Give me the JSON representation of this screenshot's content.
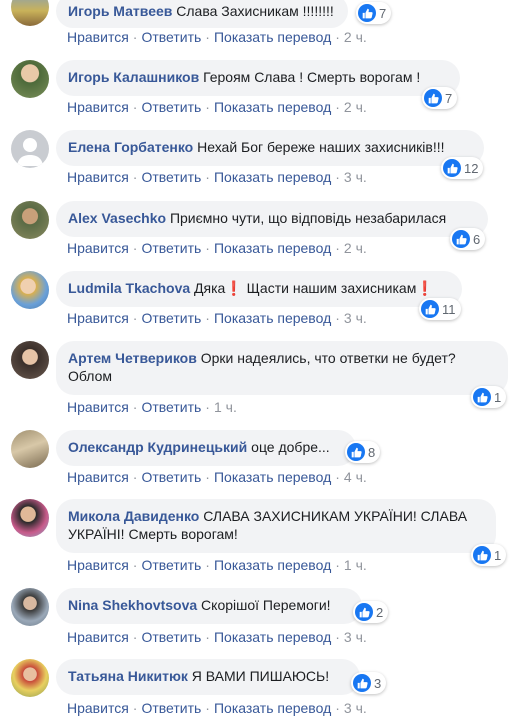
{
  "actions": {
    "like": "Нравится",
    "reply": "Ответить",
    "translate": "Показать перевод",
    "sep": "·"
  },
  "comments": [
    {
      "author": "Игорь Матвеев",
      "text": "Слава Захисникам !!!!!!!!",
      "likes": "7",
      "time": "2 ч.",
      "translate": true
    },
    {
      "author": "Игорь Калашников",
      "text": "Героям Слава ! Смерть ворогам !",
      "likes": "7",
      "time": "2 ч.",
      "translate": true
    },
    {
      "author": "Елена Горбатенко",
      "text": "Нехай Бог береже наших захисників!!!",
      "likes": "12",
      "time": "3 ч.",
      "translate": true
    },
    {
      "author": "Alex Vasechko",
      "text": "Приємно чути, що відповідь незабарилася",
      "likes": "6",
      "time": "2 ч.",
      "translate": true
    },
    {
      "author": "Ludmila Tkachova",
      "text": "Дяка❗ Щасти нашим захисникам❗",
      "likes": "11",
      "time": "3 ч.",
      "translate": true
    },
    {
      "author": "Артем Четвериков",
      "text": "Орки надеялись, что ответки не будет? Облом",
      "likes": "1",
      "time": "1 ч.",
      "translate": false
    },
    {
      "author": "Олександр Кудринецький",
      "text": "оце добре...",
      "likes": "8",
      "time": "4 ч.",
      "translate": true
    },
    {
      "author": "Микола Давиденко",
      "text": "СЛАВА ЗАХИСНИКАМ УКРАЇНИ! СЛАВА УКРАЇНІ! Смерть ворогам!",
      "likes": "1",
      "time": "1 ч.",
      "translate": true
    },
    {
      "author": "Nina Shekhovtsova",
      "text": "Скорішої Перемоги!",
      "likes": "2",
      "time": "3 ч.",
      "translate": true
    },
    {
      "author": "Татьяна Никитюк",
      "text": "Я ВАМИ ПИШАЮСЬ!",
      "likes": "3",
      "time": "3 ч.",
      "translate": true
    }
  ],
  "colors": {
    "link": "#385898",
    "bubble": "#f2f3f5",
    "like": "#1877f2",
    "meta": "#90949c"
  }
}
